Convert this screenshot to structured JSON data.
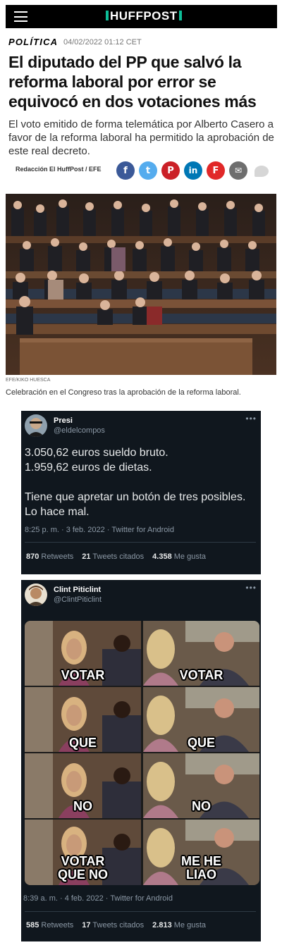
{
  "header": {
    "menu_icon": "hamburger-icon",
    "logo_text": "HUFFPOST",
    "brand_color": "#0dbe98"
  },
  "article": {
    "section": "POLÍTICA",
    "datetime": "04/02/2022 01:12 CET",
    "headline": "El diputado del PP que salvó la reforma laboral por error se equivocó en dos votaciones más",
    "subhead": "El voto emitido de forma telemática por Alberto Casero a favor de la reforma laboral ha permitido la aprobación de este real decreto.",
    "byline": "Redacción El HuffPost / EFE",
    "share_buttons": [
      {
        "icon": "facebook-icon",
        "glyph": "f",
        "color": "#3b5998"
      },
      {
        "icon": "twitter-icon",
        "glyph": "t",
        "color": "#55acee"
      },
      {
        "icon": "pinterest-icon",
        "glyph": "P",
        "color": "#cb2027"
      },
      {
        "icon": "linkedin-icon",
        "glyph": "in",
        "color": "#0077b5"
      },
      {
        "icon": "flipboard-icon",
        "glyph": "F",
        "color": "#e12828"
      },
      {
        "icon": "email-icon",
        "glyph": "✉",
        "color": "#6e6e6e"
      }
    ],
    "photo_credit": "EFE/KIKO HUESCA",
    "caption": "Celebración en el Congreso tras la aprobación de la reforma laboral."
  },
  "tweet1": {
    "name": "Presi",
    "handle": "@eldelcompos",
    "text": "3.050,62 euros sueldo bruto.\n1.959,62 euros de dietas.\n\nTiene que apretar un botón de tres posibles. Lo hace mal.",
    "timestamp": "8:25 p. m. · 3 feb. 2022 · Twitter for Android",
    "retweets": "870",
    "retweets_label": "Retweets",
    "quotes": "21",
    "quotes_label": "Tweets citados",
    "likes": "4.358",
    "likes_label": "Me gusta"
  },
  "tweet2": {
    "name": "Clint Piticlint",
    "handle": "@ClintPiticlint",
    "meme_rows": [
      {
        "left": "VOTAR",
        "right": "VOTAR"
      },
      {
        "left": "QUE",
        "right": "QUE"
      },
      {
        "left": "NO",
        "right": "NO"
      },
      {
        "left": "VOTAR\nQUE NO",
        "right": "ME HE\nLIAO"
      }
    ],
    "timestamp": "8:39 a. m. · 4 feb. 2022 · Twitter for Android",
    "retweets": "585",
    "retweets_label": "Retweets",
    "quotes": "17",
    "quotes_label": "Tweets citados",
    "likes": "2.813",
    "likes_label": "Me gusta"
  }
}
